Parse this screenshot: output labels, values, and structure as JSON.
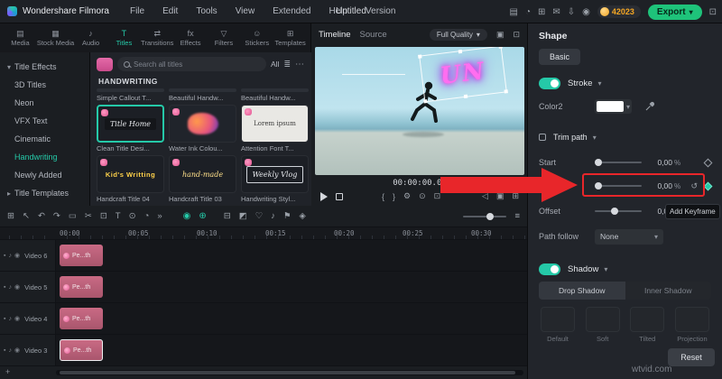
{
  "menubar": {
    "app_name": "Wondershare Filmora",
    "menus": [
      "File",
      "Edit",
      "Tools",
      "View",
      "Extended",
      "Help",
      "Version"
    ],
    "project_title": "Untitled",
    "icon_glyphs": [
      "▤",
      "◔",
      "⊞",
      "✉",
      "⇩",
      "◉",
      "⊡"
    ],
    "coin_count": "42023",
    "export_label": "Export"
  },
  "tabs": [
    {
      "label": "Media",
      "glyph": "▤"
    },
    {
      "label": "Stock Media",
      "glyph": "▦"
    },
    {
      "label": "Audio",
      "glyph": "♪"
    },
    {
      "label": "Titles",
      "glyph": "T"
    },
    {
      "label": "Transitions",
      "glyph": "⇄"
    },
    {
      "label": "Effects",
      "glyph": "fx"
    },
    {
      "label": "Filters",
      "glyph": "▽"
    },
    {
      "label": "Stickers",
      "glyph": "☺"
    },
    {
      "label": "Templates",
      "glyph": "⊞"
    }
  ],
  "sidebar": {
    "items": [
      {
        "label": "Title Effects"
      },
      {
        "label": "3D Titles"
      },
      {
        "label": "Neon"
      },
      {
        "label": "VFX Text"
      },
      {
        "label": "Cinematic"
      },
      {
        "label": "Handwriting"
      },
      {
        "label": "Newly Added"
      },
      {
        "label": "Title Templates"
      }
    ]
  },
  "library": {
    "search_placeholder": "Search all titles",
    "filter_all": "All",
    "section_title": "HANDWRITING",
    "top_labels": [
      "Simple Callout T...",
      "Beautiful Handw...",
      "Beautiful Handw..."
    ],
    "items": [
      {
        "label": "Clean Title Desi...",
        "preview": "Title Home"
      },
      {
        "label": "Water Ink Colou...",
        "preview": ""
      },
      {
        "label": "Attention Font T...",
        "preview": "Lorem ipsum"
      },
      {
        "label": "Handcraft Title 04",
        "preview": "Kid's Writting"
      },
      {
        "label": "Handcraft Title 03",
        "preview": "hand-made"
      },
      {
        "label": "Handwriting Styl...",
        "preview": "Weekly Vlog"
      }
    ]
  },
  "preview": {
    "tab_timeline": "Timeline",
    "tab_source": "Source",
    "quality": "Full Quality",
    "overlay_text": "UN",
    "timecode": "00:00:00.00"
  },
  "inspector": {
    "title": "Shape",
    "basic_label": "Basic",
    "stroke_label": "Stroke",
    "color_label": "Color2",
    "trim_path_label": "Trim path",
    "start_label": "Start",
    "start_value": "0,00",
    "end_label": "End",
    "end_value": "0,00",
    "offset_label": "Offset",
    "offset_value": "0,00",
    "percent": "%",
    "path_follow_label": "Path follow",
    "path_follow_value": "None",
    "shadow_label": "Shadow",
    "drop_shadow_tab": "Drop Shadow",
    "inner_shadow_tab": "Inner Shadow",
    "presets": [
      "Default",
      "Soft",
      "Tilted",
      "Projection"
    ],
    "tooltip_add_keyframe": "Add Keyframe",
    "reset_label": "Reset"
  },
  "timelinebar": {
    "icons_left": [
      "⊞",
      "↖",
      "↶",
      "↷",
      "▭",
      "✂",
      "⊡",
      "T",
      "⊙",
      "◔",
      "»"
    ],
    "toggles": [
      "◉",
      "⊕"
    ],
    "icons_mid": [
      "⊟",
      "◩",
      "♡",
      "♪",
      "⚑",
      "◈"
    ]
  },
  "timeline": {
    "ruler": [
      "00:00",
      "00:05",
      "00:10",
      "00:15",
      "00:20",
      "00:25",
      "00:30"
    ],
    "tracks": [
      {
        "name": "Video 6",
        "clip": "Pe...th"
      },
      {
        "name": "Video 5",
        "clip": "Pe...th"
      },
      {
        "name": "Video 4",
        "clip": "Pe...th"
      },
      {
        "name": "Video 3",
        "clip": "Pe...th"
      }
    ]
  },
  "icons": {
    "chevron_down": "▾",
    "chevron_right": "▸",
    "more": "⋯",
    "filter": "≣",
    "bracket_open": "{",
    "bracket_close": "}",
    "gear": "⚙",
    "snapshot": "⊙",
    "crop": "⊡",
    "volume": "◁",
    "fit": "▣",
    "fullscreen": "⊞",
    "reset_value": "↺",
    "menu": "≡",
    "plus": "+"
  },
  "watermark": "wtvid.com",
  "colors": {
    "accent_teal": "#25c9a8",
    "export_green": "#1ec37a",
    "coin_orange": "#f5a623",
    "annotation_red": "#e8262a",
    "clip_pink": "#c96a84"
  }
}
